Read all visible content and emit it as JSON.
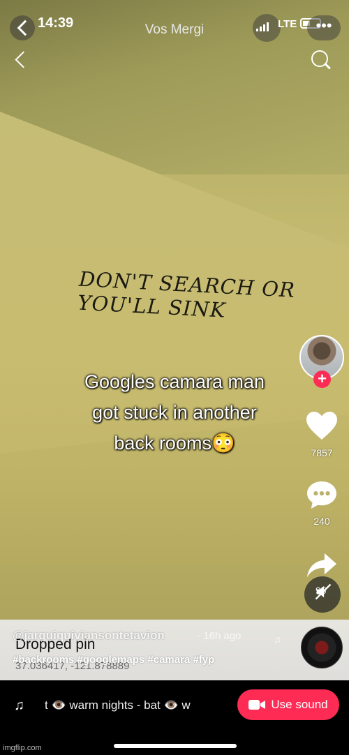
{
  "status_bar": {
    "time": "14:39",
    "account_name": "Vos Mergi",
    "carrier": "LTE",
    "more_label": "•••"
  },
  "video": {
    "wall_text": "DON'T SEARCH OR YOU'LL SINK",
    "caption_line1": "Googles camara man",
    "caption_line2": "got stuck in another",
    "caption_line3": "back rooms😳"
  },
  "rail": {
    "likes": "7857",
    "comments": "240",
    "shares": "95",
    "follow_label": "+"
  },
  "info": {
    "username": "@jarquiquiviansontetavion",
    "posted_ago": "· 16h ago",
    "hashtags": "#backrooms #googlemaps #camara #fyp",
    "pin_title": "Dropped pin",
    "pin_coords": "37.036417, -121.878889",
    "note_symbol": "♫"
  },
  "bottom": {
    "music_note": "♫",
    "ticker": "t 👁️    warm nights - bat 👁️    w",
    "use_sound_label": "Use sound"
  },
  "watermark": "imgflip.com",
  "colors": {
    "accent": "#fe2c55",
    "wall": "#c6bc72"
  }
}
